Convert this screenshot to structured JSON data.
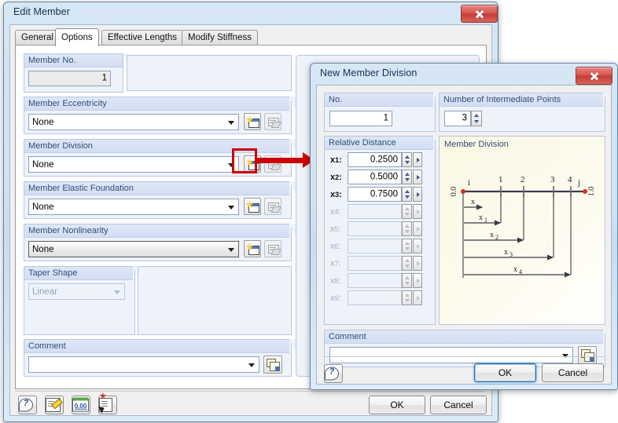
{
  "main_window": {
    "title": "Edit Member",
    "close_icon": "close-icon",
    "tabs": [
      {
        "label": "General",
        "active": false
      },
      {
        "label": "Options",
        "active": true
      },
      {
        "label": "Effective Lengths",
        "active": false
      },
      {
        "label": "Modify Stiffness",
        "active": false
      }
    ],
    "groups": {
      "member_no": {
        "label": "Member No.",
        "value": "1"
      },
      "member_eccentricity": {
        "label": "Member Eccentricity",
        "value": "None"
      },
      "member_division": {
        "label": "Member Division",
        "value": "None"
      },
      "member_elastic_foundation": {
        "label": "Member Elastic Foundation",
        "value": "None"
      },
      "member_nonlinearity": {
        "label": "Member Nonlinearity",
        "value": "None"
      },
      "taper_shape": {
        "label": "Taper Shape",
        "value": "Linear"
      },
      "comment": {
        "label": "Comment",
        "value": ""
      }
    },
    "toolbar": [
      {
        "icon": "help-icon",
        "name": "help-button"
      },
      {
        "icon": "edit-icon",
        "name": "edit-button"
      },
      {
        "icon": "numeric-icon",
        "name": "units-button"
      },
      {
        "icon": "select-icon",
        "name": "select-button"
      }
    ],
    "buttons": {
      "ok": "OK",
      "cancel": "Cancel"
    }
  },
  "dialog": {
    "title": "New Member Division",
    "close_icon": "close-icon",
    "no": {
      "label": "No.",
      "value": "1"
    },
    "intermediate_points": {
      "label": "Number of Intermediate Points",
      "value": "3"
    },
    "relative_distance": {
      "label": "Relative Distance",
      "rows": [
        {
          "label": "x",
          "sub": "1",
          "value": "0.2500",
          "enabled": true
        },
        {
          "label": "x",
          "sub": "2",
          "value": "0.5000",
          "enabled": true
        },
        {
          "label": "x",
          "sub": "3",
          "value": "0.7500",
          "enabled": true
        },
        {
          "label": "x",
          "sub": "4",
          "value": "",
          "enabled": false
        },
        {
          "label": "x",
          "sub": "5",
          "value": "",
          "enabled": false
        },
        {
          "label": "x",
          "sub": "6",
          "value": "",
          "enabled": false
        },
        {
          "label": "x",
          "sub": "7",
          "value": "",
          "enabled": false
        },
        {
          "label": "x",
          "sub": "8",
          "value": "",
          "enabled": false
        },
        {
          "label": "x",
          "sub": "9",
          "value": "",
          "enabled": false
        }
      ]
    },
    "comment": {
      "label": "Comment",
      "value": ""
    },
    "buttons": {
      "help": "help-icon",
      "ok": "OK",
      "cancel": "Cancel"
    },
    "diagram": {
      "title": "Member Division",
      "start_node": "i",
      "end_node": "j",
      "start_value": "0.0",
      "end_value": "1.0",
      "point_labels": [
        "1",
        "2",
        "3",
        "4"
      ],
      "dimension_labels": [
        "x",
        "x1",
        "x2",
        "x3",
        "x4"
      ]
    }
  },
  "annotation": {
    "highlight_color": "#cc0000",
    "target": "new-member-division-button"
  }
}
